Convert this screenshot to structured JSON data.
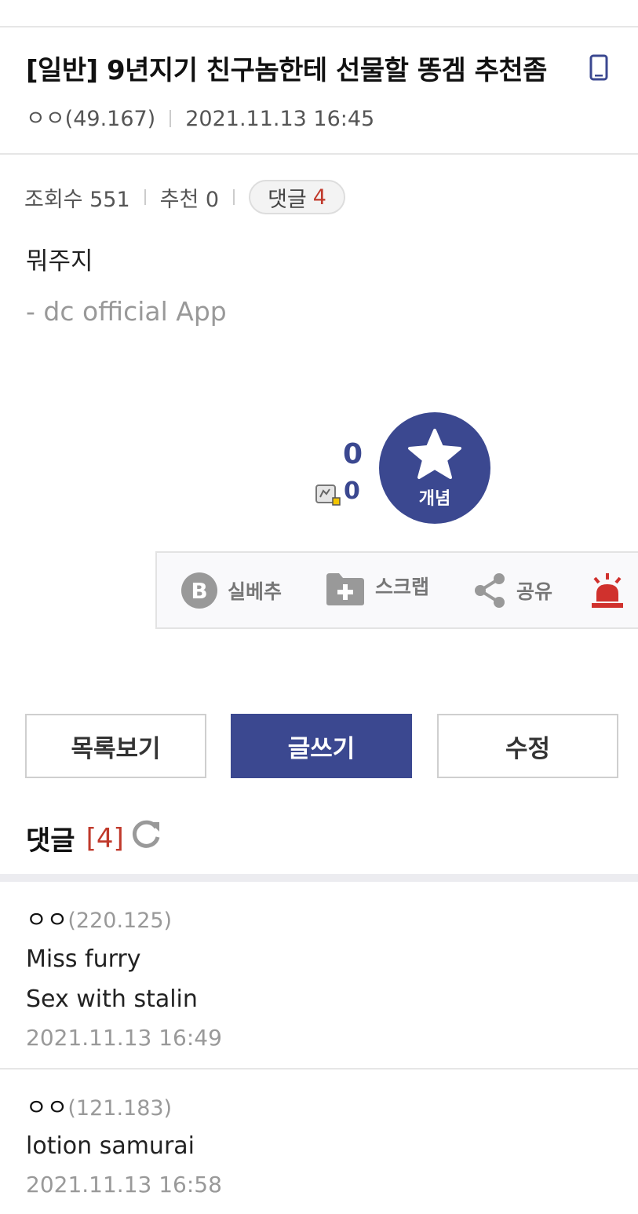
{
  "post": {
    "title": "[일반] 9년지기 친구놈한테 선물할 똥겜 추천좀",
    "author": "ㅇㅇ(49.167)",
    "date": "2021.11.13 16:45",
    "views_label": "조회수 551",
    "recommend_label": "추천 0",
    "comment_badge_label": "댓글",
    "comment_badge_count": "4",
    "body": "뭐주지",
    "signature": "- dc official App"
  },
  "recommend": {
    "up_count": "0",
    "fix_count": "0",
    "button_label": "개념"
  },
  "actions": {
    "silbe": "실베추",
    "scrap": "스크랩",
    "share": "공유"
  },
  "buttons": {
    "list": "목록보기",
    "write": "글쓰기",
    "edit": "수정"
  },
  "comments_header": {
    "label": "댓글",
    "count": "[4]"
  },
  "comments": [
    {
      "nick": "ㅇㅇ",
      "ip": "(220.125)",
      "lines": [
        "Miss furry",
        "Sex with stalin"
      ],
      "date": "2021.11.13 16:49"
    },
    {
      "nick": "ㅇㅇ",
      "ip": "(121.183)",
      "lines": [
        "lotion samurai"
      ],
      "date": "2021.11.13 16:58"
    }
  ],
  "colors": {
    "accent": "#3b4890",
    "comment_count": "#c0392b",
    "alarm": "#d0312d"
  }
}
